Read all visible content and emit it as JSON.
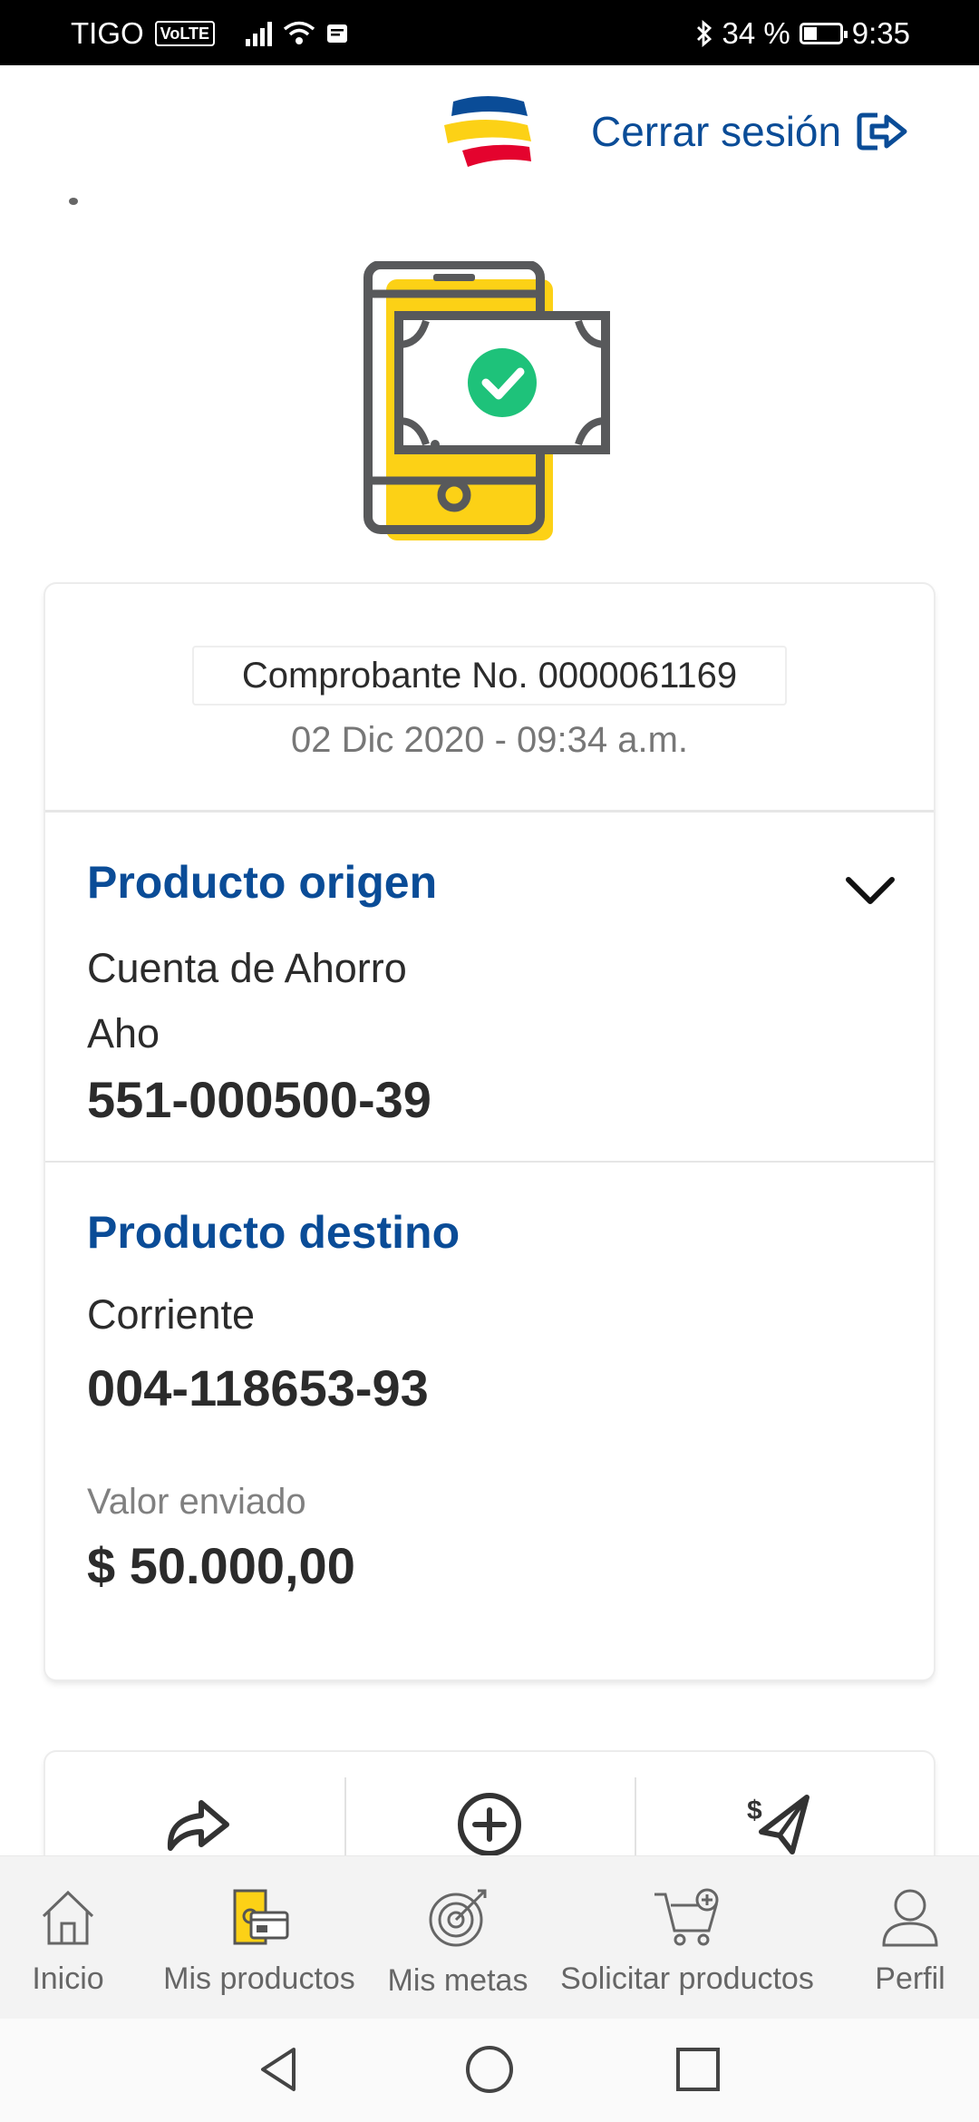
{
  "status_bar": {
    "carrier": "TIGO",
    "volte": "VoLTE",
    "battery": "34 %",
    "time": "9:35"
  },
  "header": {
    "logout_label": "Cerrar sesión",
    "brand_colors": [
      "#0a4c97",
      "#fcd116",
      "#e4032e"
    ]
  },
  "receipt": {
    "number_label": "Comprobante No. 0000061169",
    "datetime": "02 Dic 2020 - 09:34 a.m."
  },
  "origin": {
    "title": "Producto origen",
    "type": "Cuenta de Ahorro",
    "short": "Aho",
    "account": "551-000500-39"
  },
  "destination": {
    "title": "Producto destino",
    "type": "Corriente",
    "account": "004-118653-93"
  },
  "amount": {
    "label": "Valor enviado",
    "value": "$ 50.000,00"
  },
  "actions": {
    "items": [
      {
        "icon": "share-icon"
      },
      {
        "icon": "add-circle-icon"
      },
      {
        "icon": "send-money-icon"
      }
    ]
  },
  "bottom_nav": {
    "items": [
      {
        "label": "Inicio",
        "icon": "home-icon"
      },
      {
        "label": "Mis productos",
        "icon": "products-icon",
        "active": true
      },
      {
        "label": "Mis metas",
        "icon": "target-icon"
      },
      {
        "label": "Solicitar productos",
        "icon": "cart-icon"
      },
      {
        "label": "Perfil",
        "icon": "user-icon"
      }
    ]
  },
  "colors": {
    "primary": "#0a4c97",
    "accent_yellow": "#fcd116",
    "success_green": "#1ec27a",
    "icon_gray": "#58595b"
  }
}
